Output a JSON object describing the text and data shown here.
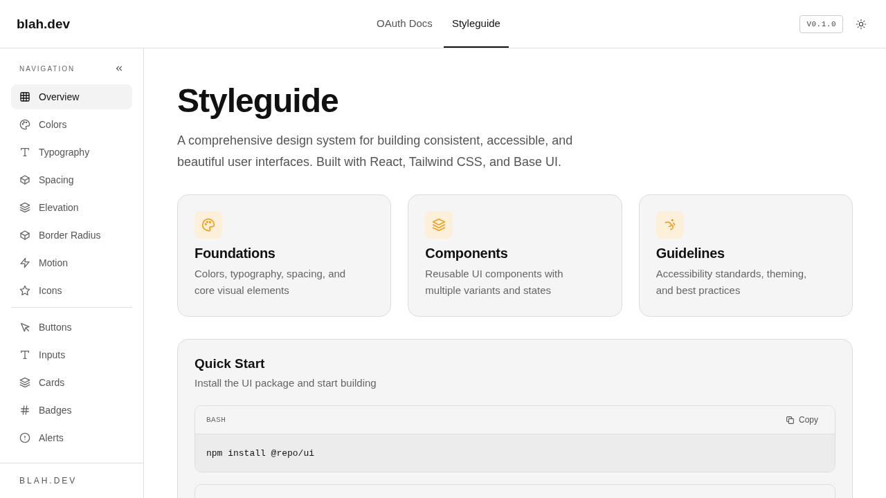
{
  "brand": "blah.dev",
  "nav_tabs": [
    {
      "label": "OAuth Docs",
      "selected": false
    },
    {
      "label": "Styleguide",
      "selected": true
    }
  ],
  "version_badge": "V0.1.0",
  "sidebar": {
    "heading": "NAVIGATION",
    "groups": [
      [
        {
          "label": "Overview",
          "selected": true
        },
        {
          "label": "Colors",
          "selected": false
        },
        {
          "label": "Typography",
          "selected": false
        },
        {
          "label": "Spacing",
          "selected": false
        },
        {
          "label": "Elevation",
          "selected": false
        },
        {
          "label": "Border Radius",
          "selected": false
        },
        {
          "label": "Motion",
          "selected": false
        },
        {
          "label": "Icons",
          "selected": false
        }
      ],
      [
        {
          "label": "Buttons",
          "selected": false
        },
        {
          "label": "Inputs",
          "selected": false
        },
        {
          "label": "Cards",
          "selected": false
        },
        {
          "label": "Badges",
          "selected": false
        },
        {
          "label": "Alerts",
          "selected": false
        }
      ]
    ],
    "footer": "BLAH.DEV"
  },
  "page": {
    "title": "Styleguide",
    "intro": "A comprehensive design system for building consistent, accessible, and beautiful user interfaces. Built with React, Tailwind CSS, and Base UI.",
    "cards": [
      {
        "title": "Foundations",
        "text": "Colors, typography, spacing, and core visual elements"
      },
      {
        "title": "Components",
        "text": "Reusable UI components with multiple variants and states"
      },
      {
        "title": "Guidelines",
        "text": "Accessibility standards, theming, and best practices"
      }
    ],
    "quick_start": {
      "title": "Quick Start",
      "subtitle": "Install the UI package and start building",
      "code_language": "BASH",
      "copy_label": "Copy",
      "code": "npm install @repo/ui"
    }
  }
}
